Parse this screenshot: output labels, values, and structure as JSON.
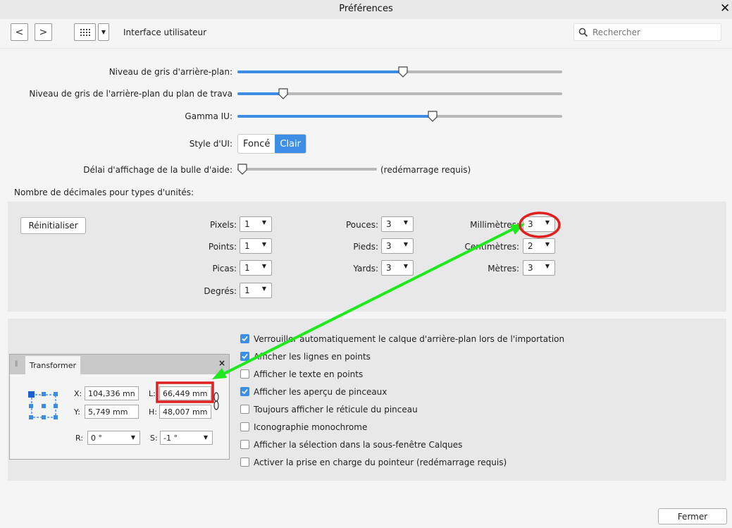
{
  "window": {
    "title": "Préférences",
    "close_icon": "close-icon"
  },
  "toolbar": {
    "back_glyph": "<",
    "forward_glyph": ">",
    "breadcrumb": "Interface utilisateur",
    "search_placeholder": "Rechercher"
  },
  "ui_settings": {
    "bg_gray_label": "Niveau de gris d'arrière-plan:",
    "bg_gray_level": 0.51,
    "workspace_gray_label": "Niveau de gris de l'arrière-plan du plan de trava",
    "workspace_gray_level": 0.14,
    "gamma_label": "Gamma IU:",
    "gamma_level": 0.6,
    "style_label": "Style d'UI:",
    "style_options": [
      "Foncé",
      "Clair"
    ],
    "style_selected": "Clair",
    "tooltip_delay_label": "Délai d'affichage de la bulle d'aide:",
    "tooltip_delay_level": 0.02,
    "tooltip_note": "(redémarrage requis)"
  },
  "decimals": {
    "heading": "Nombre de décimales pour types d'unités:",
    "reset_label": "Réinitialiser",
    "units": [
      {
        "key": "pixels",
        "label": "Pixels:",
        "value": "1"
      },
      {
        "key": "points",
        "label": "Points:",
        "value": "1"
      },
      {
        "key": "picas",
        "label": "Picas:",
        "value": "1"
      },
      {
        "key": "degrees",
        "label": "Degrés:",
        "value": "1"
      },
      {
        "key": "inches",
        "label": "Pouces:",
        "value": "3"
      },
      {
        "key": "feet",
        "label": "Pieds:",
        "value": "3"
      },
      {
        "key": "yards",
        "label": "Yards:",
        "value": "3"
      },
      {
        "key": "millimeters",
        "label": "Millimètres:",
        "value": "3"
      },
      {
        "key": "centimeters",
        "label": "Centimètres:",
        "value": "2"
      },
      {
        "key": "meters",
        "label": "Mètres:",
        "value": "3"
      }
    ]
  },
  "options": [
    {
      "label": "Verrouiller automatiquement le calque d'arrière-plan lors de l'importation",
      "checked": true
    },
    {
      "label": "Afficher les lignes en points",
      "checked": true
    },
    {
      "label": "Afficher le texte en points",
      "checked": false
    },
    {
      "label": "Afficher les aperçu de pinceaux",
      "checked": true
    },
    {
      "label": "Toujours afficher le réticule du pinceau",
      "checked": false
    },
    {
      "label": "Iconographie monochrome",
      "checked": false
    },
    {
      "label": "Afficher la sélection dans la sous-fenêtre Calques",
      "checked": false
    },
    {
      "label": "Activer la prise en charge du pointeur (redémarrage requis)",
      "checked": false
    }
  ],
  "transform_panel": {
    "title": "Transformer",
    "x_label": "X:",
    "x_value": "104,336 mn",
    "y_label": "Y:",
    "y_value": "5,749 mm",
    "w_label": "L:",
    "w_value": "66,449 mm",
    "h_label": "H:",
    "h_value": "48,007 mm",
    "r_label": "R:",
    "r_value": "0 °",
    "s_label": "S:",
    "s_value": "-1 °"
  },
  "footer": {
    "close_label": "Fermer"
  },
  "colors": {
    "accent": "#3b8ce4",
    "annotation_red": "#e01f1f",
    "annotation_green": "#1ee81e"
  }
}
